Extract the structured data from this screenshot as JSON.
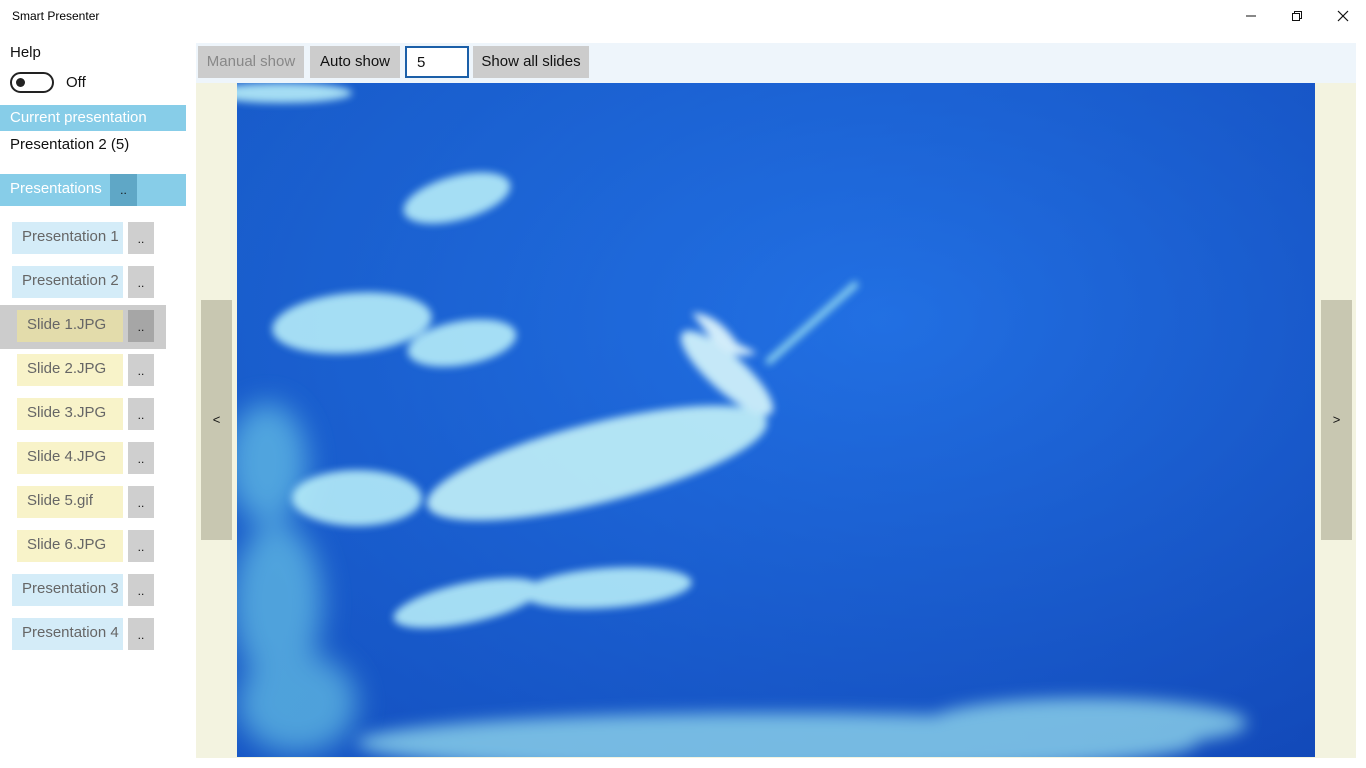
{
  "window": {
    "title": "Smart Presenter",
    "minimize_icon": "minimize-icon",
    "maximize_icon": "restore-icon",
    "close_icon": "close-icon"
  },
  "sidebar": {
    "help_label": "Help",
    "help_toggle_state": "Off",
    "current_header": "Current presentation",
    "current_presentation": "Presentation 2 (5)",
    "presentations_header": "Presentations",
    "more_label": "..",
    "items": [
      {
        "label": "Presentation 1",
        "kind": "presentation"
      },
      {
        "label": "Presentation 2",
        "kind": "presentation"
      },
      {
        "label": "Slide 1.JPG",
        "kind": "slide",
        "selected": true
      },
      {
        "label": "Slide 2.JPG",
        "kind": "slide"
      },
      {
        "label": "Slide 3.JPG",
        "kind": "slide"
      },
      {
        "label": "Slide 4.JPG",
        "kind": "slide"
      },
      {
        "label": "Slide 5.gif",
        "kind": "slide"
      },
      {
        "label": "Slide 6.JPG",
        "kind": "slide"
      },
      {
        "label": "Presentation 3",
        "kind": "presentation"
      },
      {
        "label": "Presentation 4",
        "kind": "presentation"
      }
    ]
  },
  "toolbar": {
    "manual_show": "Manual show",
    "auto_show": "Auto show",
    "interval_value": "5",
    "show_all": "Show all slides"
  },
  "viewer": {
    "prev_label": "<",
    "next_label": ">",
    "image_description": "underwater-dolphin-photo"
  },
  "colors": {
    "header_blue": "#87cde8",
    "presentation_item": "#d4ecf8",
    "slide_item": "#f8f3c9",
    "viewer_background": "#f3f3e0",
    "input_border": "#1b5fa8"
  }
}
